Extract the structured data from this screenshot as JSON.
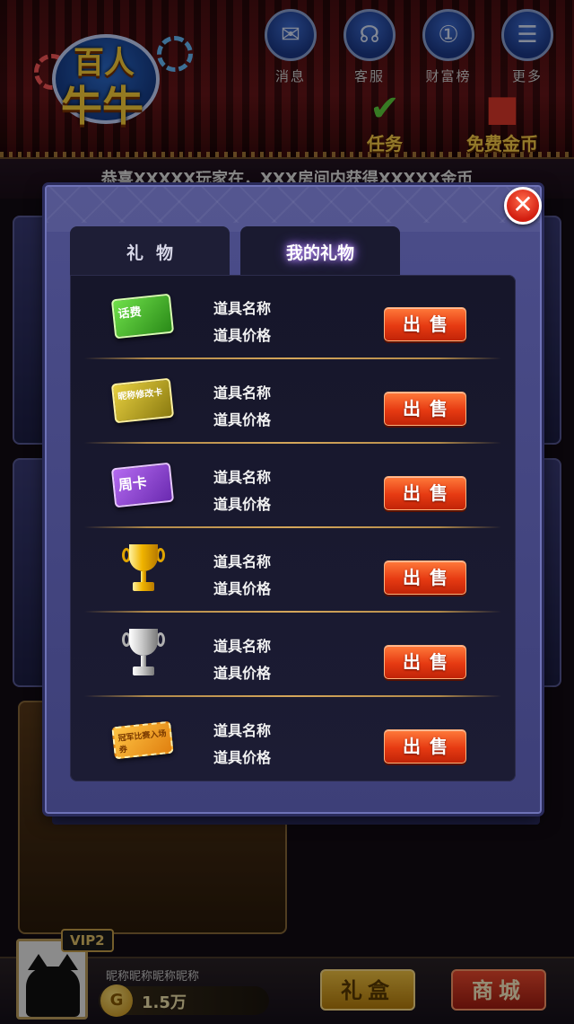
{
  "header": {
    "logo_line1": "百人",
    "logo_line2": "牛牛",
    "nav": [
      {
        "label": "消息",
        "icon": "envelope-icon",
        "glyph": "✉"
      },
      {
        "label": "客服",
        "icon": "headset-icon",
        "glyph": "☊"
      },
      {
        "label": "财富榜",
        "icon": "medal-icon",
        "glyph": "①"
      },
      {
        "label": "更多",
        "icon": "menu-list-icon",
        "glyph": "☰"
      }
    ],
    "task_label": "任务",
    "free_coins_label": "免费金币"
  },
  "marquee": "恭喜XXXXX玩家在，XXX房间内获得XXXXX金币",
  "modal": {
    "close_glyph": "✕",
    "tabs": [
      {
        "label": "礼物",
        "active": false
      },
      {
        "label": "我的礼物",
        "active": true
      }
    ],
    "items": [
      {
        "icon": "phone-credit-card-icon",
        "icon_text": "话费",
        "name": "道具名称",
        "price": "道具价格",
        "sell": "出售"
      },
      {
        "icon": "rename-card-icon",
        "icon_text": "昵称修改卡",
        "name": "道具名称",
        "price": "道具价格",
        "sell": "出售"
      },
      {
        "icon": "week-card-icon",
        "icon_text": "周卡",
        "name": "道具名称",
        "price": "道具价格",
        "sell": "出售"
      },
      {
        "icon": "gold-trophy-icon",
        "name": "道具名称",
        "price": "道具价格",
        "sell": "出售"
      },
      {
        "icon": "silver-trophy-icon",
        "name": "道具名称",
        "price": "道具价格",
        "sell": "出售"
      },
      {
        "icon": "match-ticket-icon",
        "icon_text": "冠军比赛入场券",
        "name": "道具名称",
        "price": "道具价格",
        "sell": "出售"
      }
    ]
  },
  "player": {
    "vip": "VIP2",
    "nickname": "昵称昵称昵称昵称",
    "coins": "1.5万",
    "coin_glyph": "G"
  },
  "bottom": {
    "gift_box": "礼盒",
    "shop": "商城"
  },
  "colors": {
    "sell_button": "#e63a12",
    "modal_frame": "#4b4d8a",
    "panel": "#16162a",
    "separator": "#d4a65a"
  }
}
